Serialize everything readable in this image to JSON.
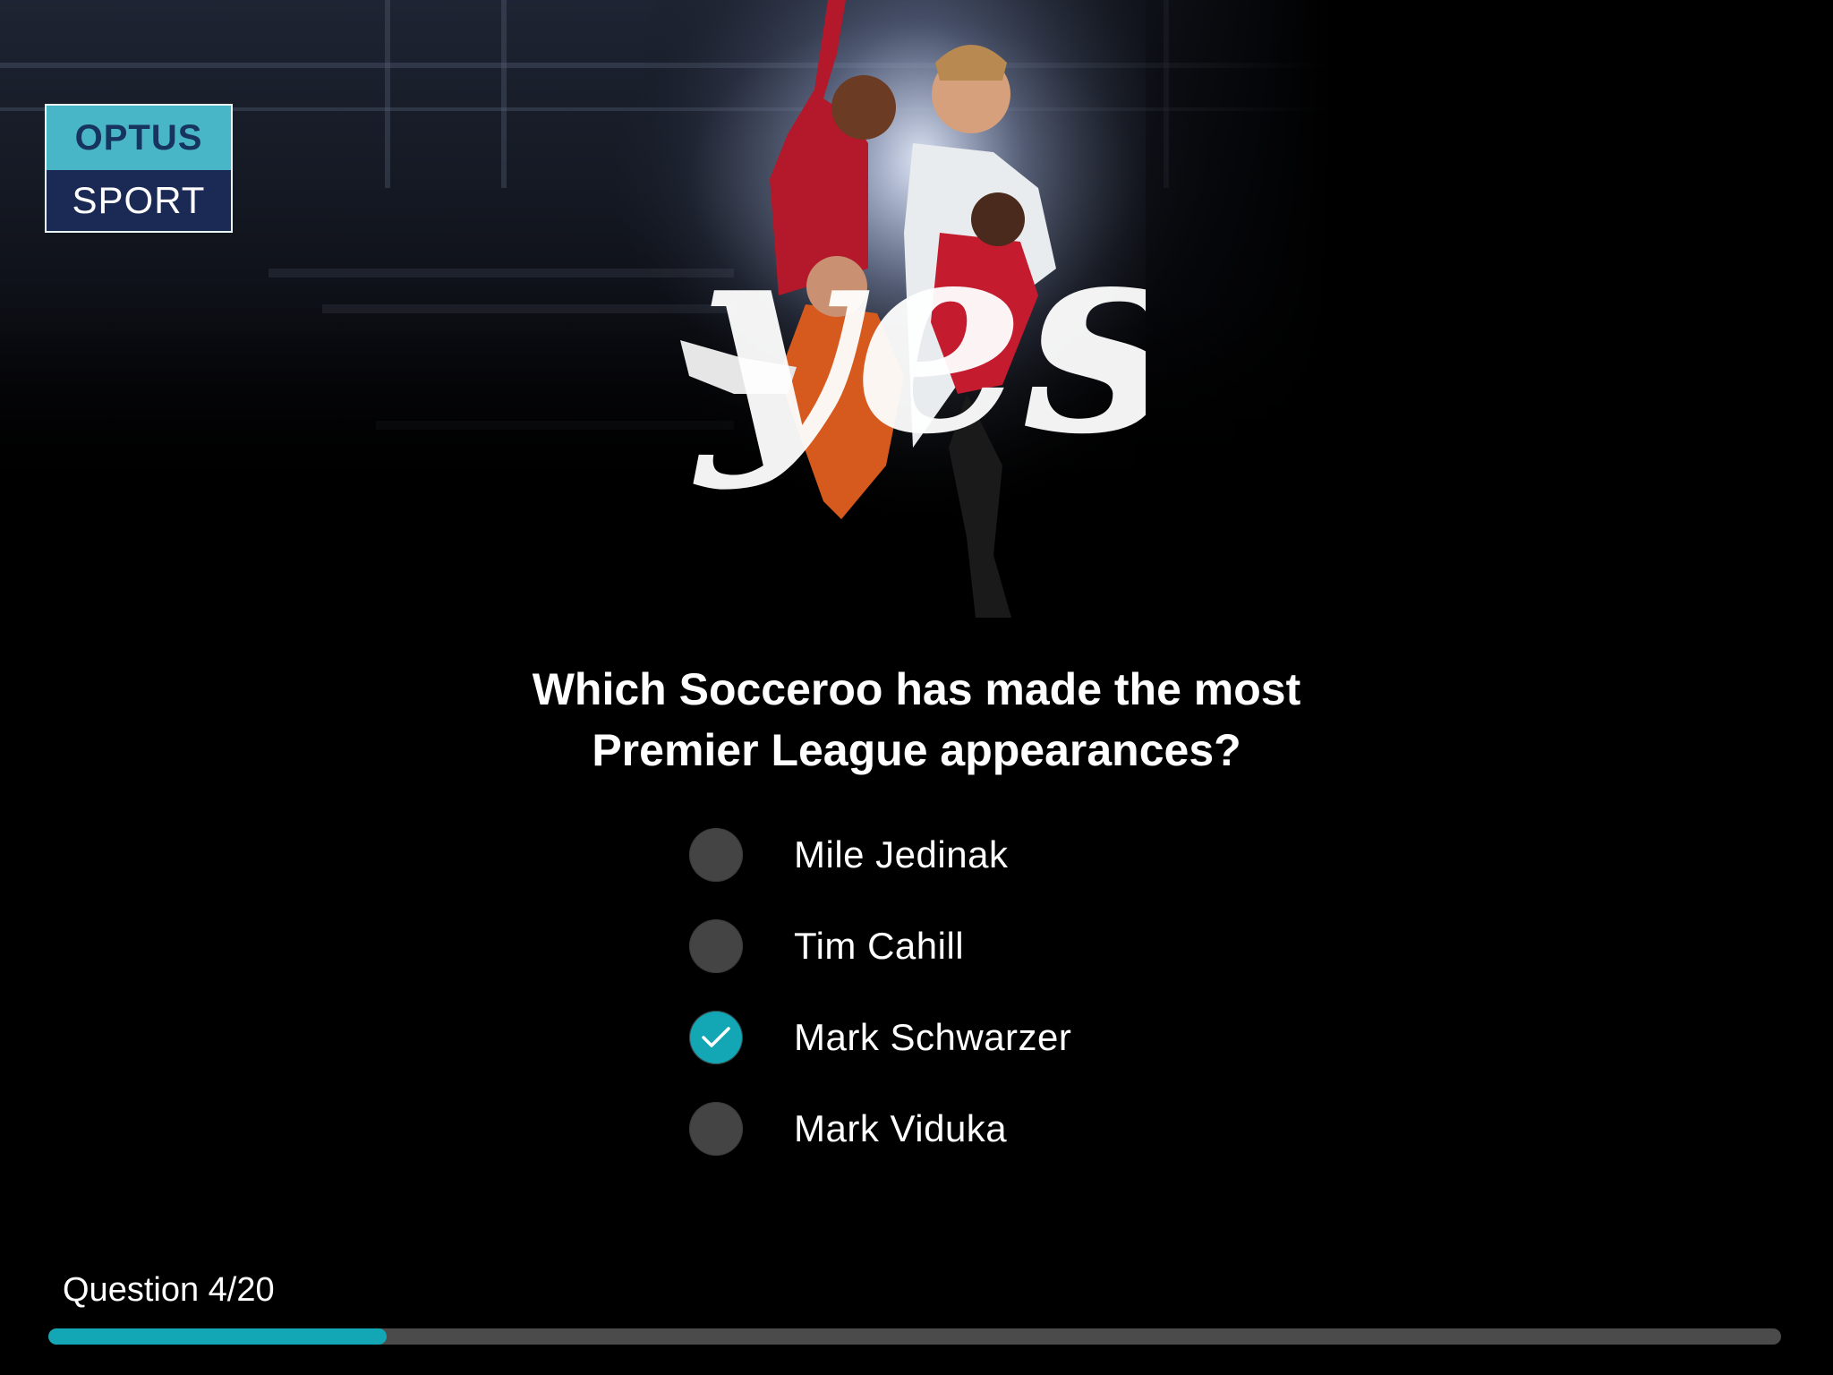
{
  "logo": {
    "top": "OPTUS",
    "bottom": "SPORT"
  },
  "hero": {
    "script_word": "yes"
  },
  "question": {
    "line1": "Which Socceroo has made the most",
    "line2": "Premier League appearances?"
  },
  "options": [
    {
      "label": "Mile Jedinak",
      "selected": false
    },
    {
      "label": "Tim Cahill",
      "selected": false
    },
    {
      "label": "Mark Schwarzer",
      "selected": true
    },
    {
      "label": "Mark Viduka",
      "selected": false
    }
  ],
  "progress": {
    "label": "Question 4/20",
    "fraction": 0.195
  },
  "colors": {
    "accent": "#13a6b4",
    "logo_top_bg": "#49b6c8",
    "logo_bottom_bg": "#1b2a55",
    "radio_idle": "#444444",
    "track": "#4b4b4b"
  },
  "icons": {
    "check": "checkmark-icon"
  }
}
